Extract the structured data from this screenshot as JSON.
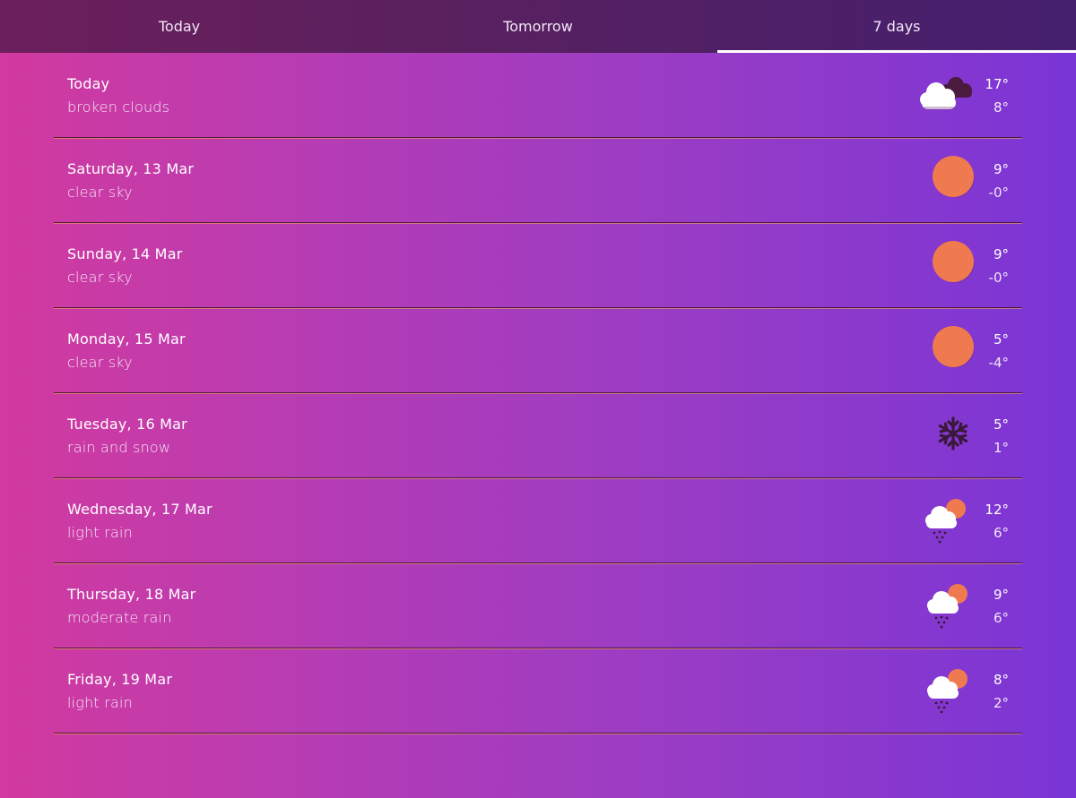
{
  "tabs": [
    {
      "label": "Today"
    },
    {
      "label": "Tomorrow"
    },
    {
      "label": "7 days"
    }
  ],
  "active_tab": "7 days",
  "colors": {
    "sun": "#ef7a4f",
    "cloud": "#ffffff",
    "dark_cloud": "#4a1a3f",
    "snow": "#3a1838"
  },
  "forecast": [
    {
      "day": "Today",
      "description": "broken clouds",
      "max": "17°",
      "min": "8°",
      "icon": "broken-clouds-icon"
    },
    {
      "day": "Saturday, 13 Mar",
      "description": "clear sky",
      "max": "9°",
      "min": "-0°",
      "icon": "clear-sky-sun-icon"
    },
    {
      "day": "Sunday, 14 Mar",
      "description": "clear sky",
      "max": "9°",
      "min": "-0°",
      "icon": "clear-sky-sun-icon"
    },
    {
      "day": "Monday, 15 Mar",
      "description": "clear sky",
      "max": "5°",
      "min": "-4°",
      "icon": "clear-sky-sun-icon"
    },
    {
      "day": "Tuesday, 16 Mar",
      "description": "rain and snow",
      "max": "5°",
      "min": "1°",
      "icon": "snowflake-icon"
    },
    {
      "day": "Wednesday, 17 Mar",
      "description": "light rain",
      "max": "12°",
      "min": "6°",
      "icon": "rain-cloud-sun-icon"
    },
    {
      "day": "Thursday, 18 Mar",
      "description": "moderate rain",
      "max": "9°",
      "min": "6°",
      "icon": "rain-cloud-sun-icon"
    },
    {
      "day": "Friday, 19 Mar",
      "description": "light rain",
      "max": "8°",
      "min": "2°",
      "icon": "rain-cloud-sun-icon"
    }
  ]
}
